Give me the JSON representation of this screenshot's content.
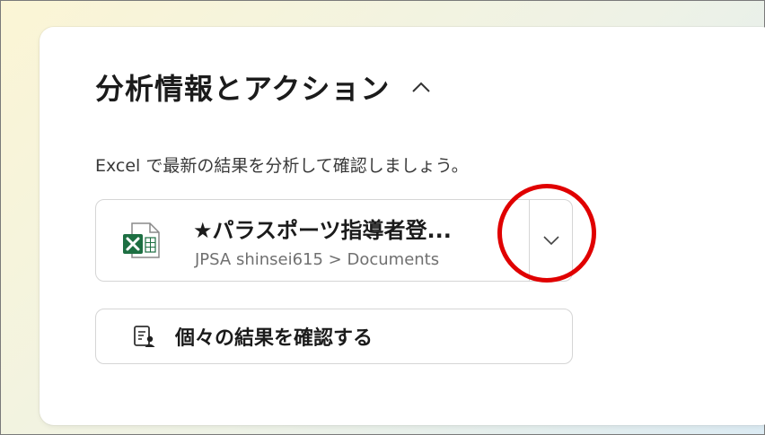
{
  "section": {
    "title": "分析情報とアクション",
    "collapse_icon": "chevron-up-icon",
    "subtitle": "Excel で最新の結果を分析して確認しましょう。"
  },
  "file": {
    "name": "★パラスポーツ指導者登...",
    "path": "JPSA shinsei615 > Documents",
    "icon": "excel-file-icon",
    "dropdown_icon": "chevron-down-icon"
  },
  "results_button": {
    "label": "個々の結果を確認する",
    "icon": "clipboard-person-icon"
  },
  "colors": {
    "excel_green": "#1d6f42",
    "highlight_red": "#e00000"
  }
}
